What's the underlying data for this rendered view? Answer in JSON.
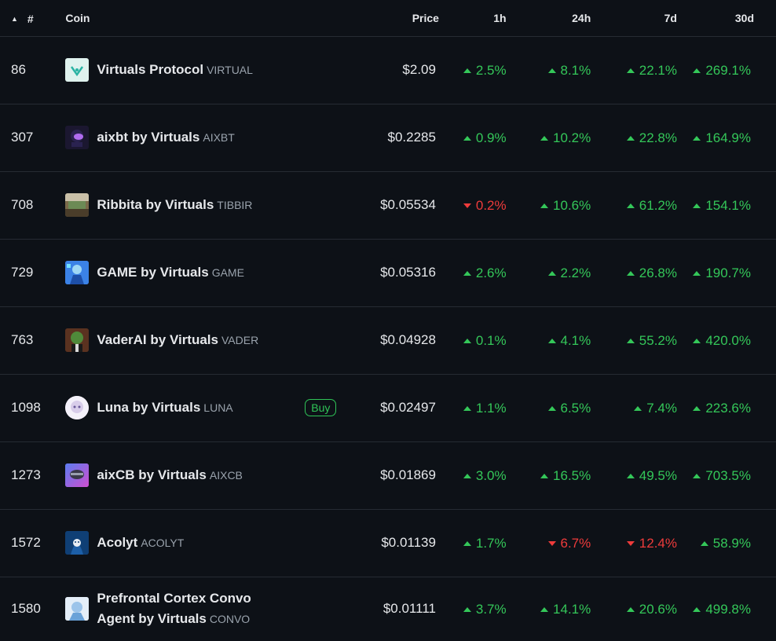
{
  "header": {
    "rank": "#",
    "coin": "Coin",
    "price": "Price",
    "h1": "1h",
    "h24": "24h",
    "d7": "7d",
    "d30": "30d"
  },
  "colors": {
    "up": "#34c759",
    "down": "#ee3b3b",
    "buy": "#2fc457",
    "background": "#0d1117"
  },
  "rows": [
    {
      "rank": "86",
      "name": "Virtuals Protocol",
      "symbol": "VIRTUAL",
      "icon": "virtuals-logo-icon",
      "price": "$2.09",
      "h1": "2.5%",
      "h1_dir": "up",
      "h24": "8.1%",
      "h24_dir": "up",
      "d7": "22.1%",
      "d7_dir": "up",
      "d30": "269.1%",
      "d30_dir": "up"
    },
    {
      "rank": "307",
      "name": "aixbt by Virtuals",
      "symbol": "AIXBT",
      "icon": "aixbt-avatar-icon",
      "price": "$0.2285",
      "h1": "0.9%",
      "h1_dir": "up",
      "h24": "10.2%",
      "h24_dir": "up",
      "d7": "22.8%",
      "d7_dir": "up",
      "d30": "164.9%",
      "d30_dir": "up"
    },
    {
      "rank": "708",
      "name": "Ribbita by Virtuals",
      "symbol": "TIBBIR",
      "icon": "ribbita-avatar-icon",
      "price": "$0.05534",
      "h1": "0.2%",
      "h1_dir": "down",
      "h24": "10.6%",
      "h24_dir": "up",
      "d7": "61.2%",
      "d7_dir": "up",
      "d30": "154.1%",
      "d30_dir": "up"
    },
    {
      "rank": "729",
      "name": "GAME by Virtuals",
      "symbol": "GAME",
      "icon": "game-avatar-icon",
      "price": "$0.05316",
      "h1": "2.6%",
      "h1_dir": "up",
      "h24": "2.2%",
      "h24_dir": "up",
      "d7": "26.8%",
      "d7_dir": "up",
      "d30": "190.7%",
      "d30_dir": "up"
    },
    {
      "rank": "763",
      "name": "VaderAI by Virtuals",
      "symbol": "VADER",
      "icon": "vader-avatar-icon",
      "price": "$0.04928",
      "h1": "0.1%",
      "h1_dir": "up",
      "h24": "4.1%",
      "h24_dir": "up",
      "d7": "55.2%",
      "d7_dir": "up",
      "d30": "420.0%",
      "d30_dir": "up"
    },
    {
      "rank": "1098",
      "name": "Luna by Virtuals",
      "symbol": "LUNA",
      "icon": "luna-avatar-icon",
      "buy": "Buy",
      "price": "$0.02497",
      "h1": "1.1%",
      "h1_dir": "up",
      "h24": "6.5%",
      "h24_dir": "up",
      "d7": "7.4%",
      "d7_dir": "up",
      "d30": "223.6%",
      "d30_dir": "up"
    },
    {
      "rank": "1273",
      "name": "aixCB by Virtuals",
      "symbol": "AIXCB",
      "icon": "aixcb-avatar-icon",
      "price": "$0.01869",
      "h1": "3.0%",
      "h1_dir": "up",
      "h24": "16.5%",
      "h24_dir": "up",
      "d7": "49.5%",
      "d7_dir": "up",
      "d30": "703.5%",
      "d30_dir": "up"
    },
    {
      "rank": "1572",
      "name": "Acolyt",
      "symbol": "ACOLYT",
      "icon": "acolyt-avatar-icon",
      "price": "$0.01139",
      "h1": "1.7%",
      "h1_dir": "up",
      "h24": "6.7%",
      "h24_dir": "down",
      "d7": "12.4%",
      "d7_dir": "down",
      "d30": "58.9%",
      "d30_dir": "up"
    },
    {
      "rank": "1580",
      "name": "Prefrontal Cortex Convo Agent by Virtuals",
      "name_line1": "Prefrontal Cortex Convo",
      "name_line2": "Agent by Virtuals",
      "symbol": "CONVO",
      "icon": "convo-avatar-icon",
      "price": "$0.01111",
      "h1": "3.7%",
      "h1_dir": "up",
      "h24": "14.1%",
      "h24_dir": "up",
      "d7": "20.6%",
      "d7_dir": "up",
      "d30": "499.8%",
      "d30_dir": "up"
    }
  ]
}
